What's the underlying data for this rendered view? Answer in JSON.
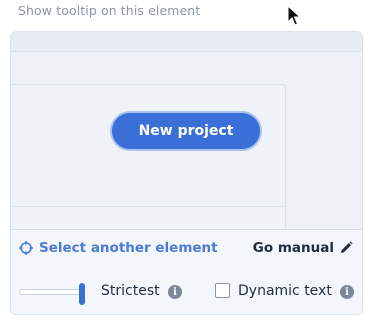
{
  "heading": "Show tooltip on this element",
  "preview": {
    "button_label": "New project"
  },
  "toolbar": {
    "select_another": "Select another element",
    "go_manual": "Go manual"
  },
  "controls": {
    "strictness_label": "Strictest",
    "strictness_value": 1.0,
    "dynamic_text_label": "Dynamic text",
    "dynamic_text_checked": false
  },
  "colors": {
    "accent": "#3a6fd8",
    "link": "#4a7bd8",
    "panel_bg": "#f3f6fa"
  },
  "icons": {
    "select_another": "crosshair-icon",
    "go_manual": "pencil-icon",
    "info": "info-icon",
    "cursor": "mouse-cursor-icon"
  }
}
